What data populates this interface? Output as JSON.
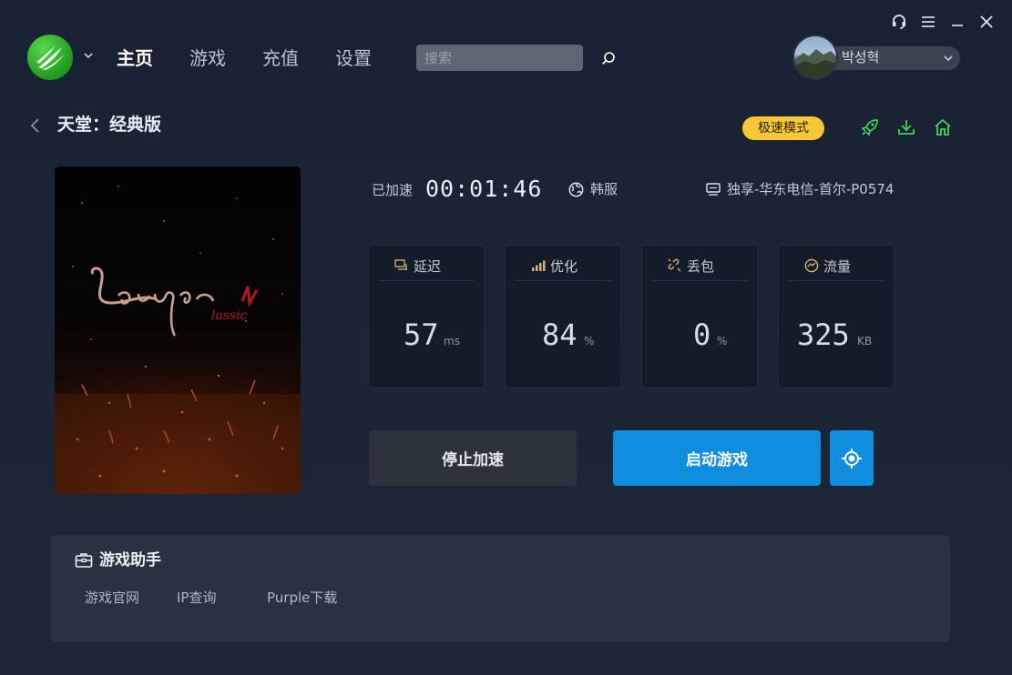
{
  "nav": {
    "items": [
      {
        "label": "主页",
        "active": true
      },
      {
        "label": "游戏",
        "active": false
      },
      {
        "label": "充值",
        "active": false
      },
      {
        "label": "设置",
        "active": false
      }
    ]
  },
  "search": {
    "placeholder": "搜索"
  },
  "user": {
    "name": "박성혁"
  },
  "page": {
    "title": "天堂：经典版",
    "mode_badge": "极速模式"
  },
  "status": {
    "accelerated_label": "已加速",
    "timer": "00:01:46",
    "region": "韩服",
    "server": "独享-华东电信-首尔-P0574"
  },
  "metrics": [
    {
      "label": "延迟",
      "value": "57",
      "unit": "ms"
    },
    {
      "label": "优化",
      "value": "84",
      "unit": "%"
    },
    {
      "label": "丢包",
      "value": "0",
      "unit": "%"
    },
    {
      "label": "流量",
      "value": "325",
      "unit": "KB"
    }
  ],
  "buttons": {
    "stop": "停止加速",
    "start": "启动游戏"
  },
  "helper": {
    "title": "游戏助手",
    "links": [
      "游戏官网",
      "IP查询",
      "Purple下载"
    ]
  },
  "colors": {
    "accent_blue": "#0f8ee0",
    "badge_yellow": "#f7c833",
    "icon_green": "#3fd15a",
    "logo_green": "#2aa72a"
  }
}
